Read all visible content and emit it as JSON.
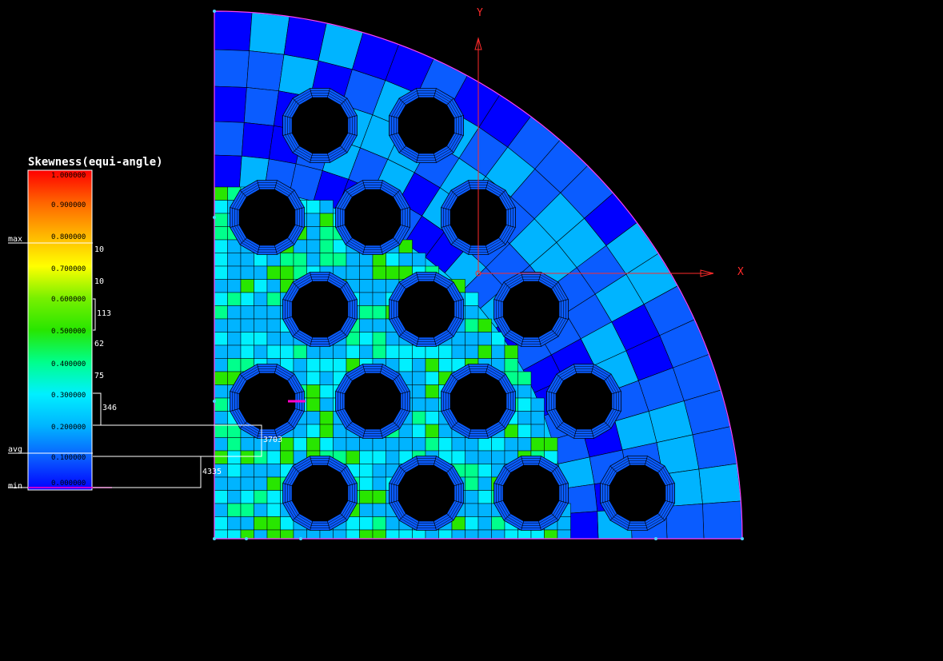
{
  "legend": {
    "title": "Skewness(equi-angle)",
    "ticks": [
      "1.000000",
      "0.900000",
      "0.800000",
      "0.700000",
      "0.600000",
      "0.500000",
      "0.400000",
      "0.300000",
      "0.200000",
      "0.100000",
      "0.000000"
    ],
    "markers": {
      "max": "max",
      "avg": "avg",
      "min": "min"
    },
    "counts": [
      "10",
      "10",
      "113",
      "62",
      "75",
      "346",
      "3703",
      "4335"
    ]
  },
  "axes": {
    "x": "X",
    "y": "Y"
  },
  "colors": {
    "background": "#000000",
    "mesh_edge": "#000000",
    "axis": "#ff2a2a",
    "hole": "#000000",
    "min_marker": "#ff00cc"
  },
  "colormap": [
    "#0000ff",
    "#0a5cff",
    "#00b4ff",
    "#00f0ff",
    "#00ff8c",
    "#28e600",
    "#b4ff00",
    "#ffff00",
    "#ffb400",
    "#ff6400",
    "#ff0000"
  ]
}
